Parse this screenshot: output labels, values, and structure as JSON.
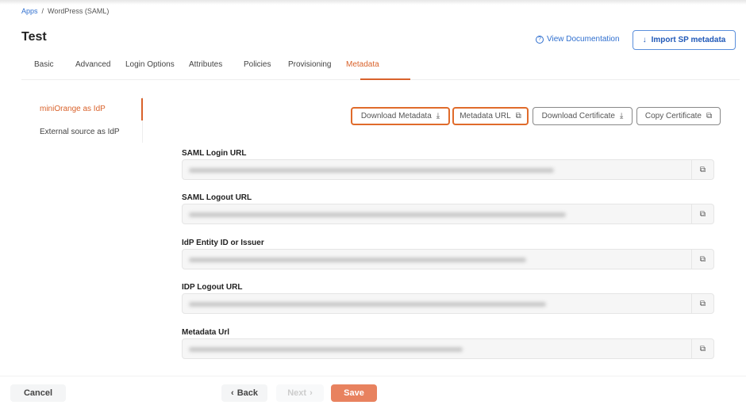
{
  "breadcrumb": {
    "root": "Apps",
    "separator": "/",
    "current": "WordPress (SAML)"
  },
  "title": "Test",
  "header": {
    "view_docs": "View Documentation",
    "import": "Import SP metadata"
  },
  "tabs": [
    "Basic",
    "Advanced",
    "Login Options",
    "Attributes",
    "Policies",
    "Provisioning",
    "Metadata"
  ],
  "active_tab": "Metadata",
  "sidebar": {
    "items": [
      "miniOrange as IdP",
      "External source as IdP"
    ],
    "active": "miniOrange as IdP"
  },
  "actions": {
    "download_metadata": "Download Metadata",
    "metadata_url": "Metadata URL",
    "download_certificate": "Download Certificate",
    "copy_certificate": "Copy Certificate"
  },
  "fields": [
    {
      "label": "SAML Login URL"
    },
    {
      "label": "SAML Logout URL"
    },
    {
      "label": "IdP Entity ID or Issuer"
    },
    {
      "label": "IDP Logout URL"
    },
    {
      "label": "Metadata Url"
    }
  ],
  "footer": {
    "cancel": "Cancel",
    "back": "Back",
    "next": "Next",
    "save": "Save"
  },
  "colors": {
    "accent": "#d9622b",
    "link": "#2f6fcf",
    "save": "#e8825f"
  }
}
